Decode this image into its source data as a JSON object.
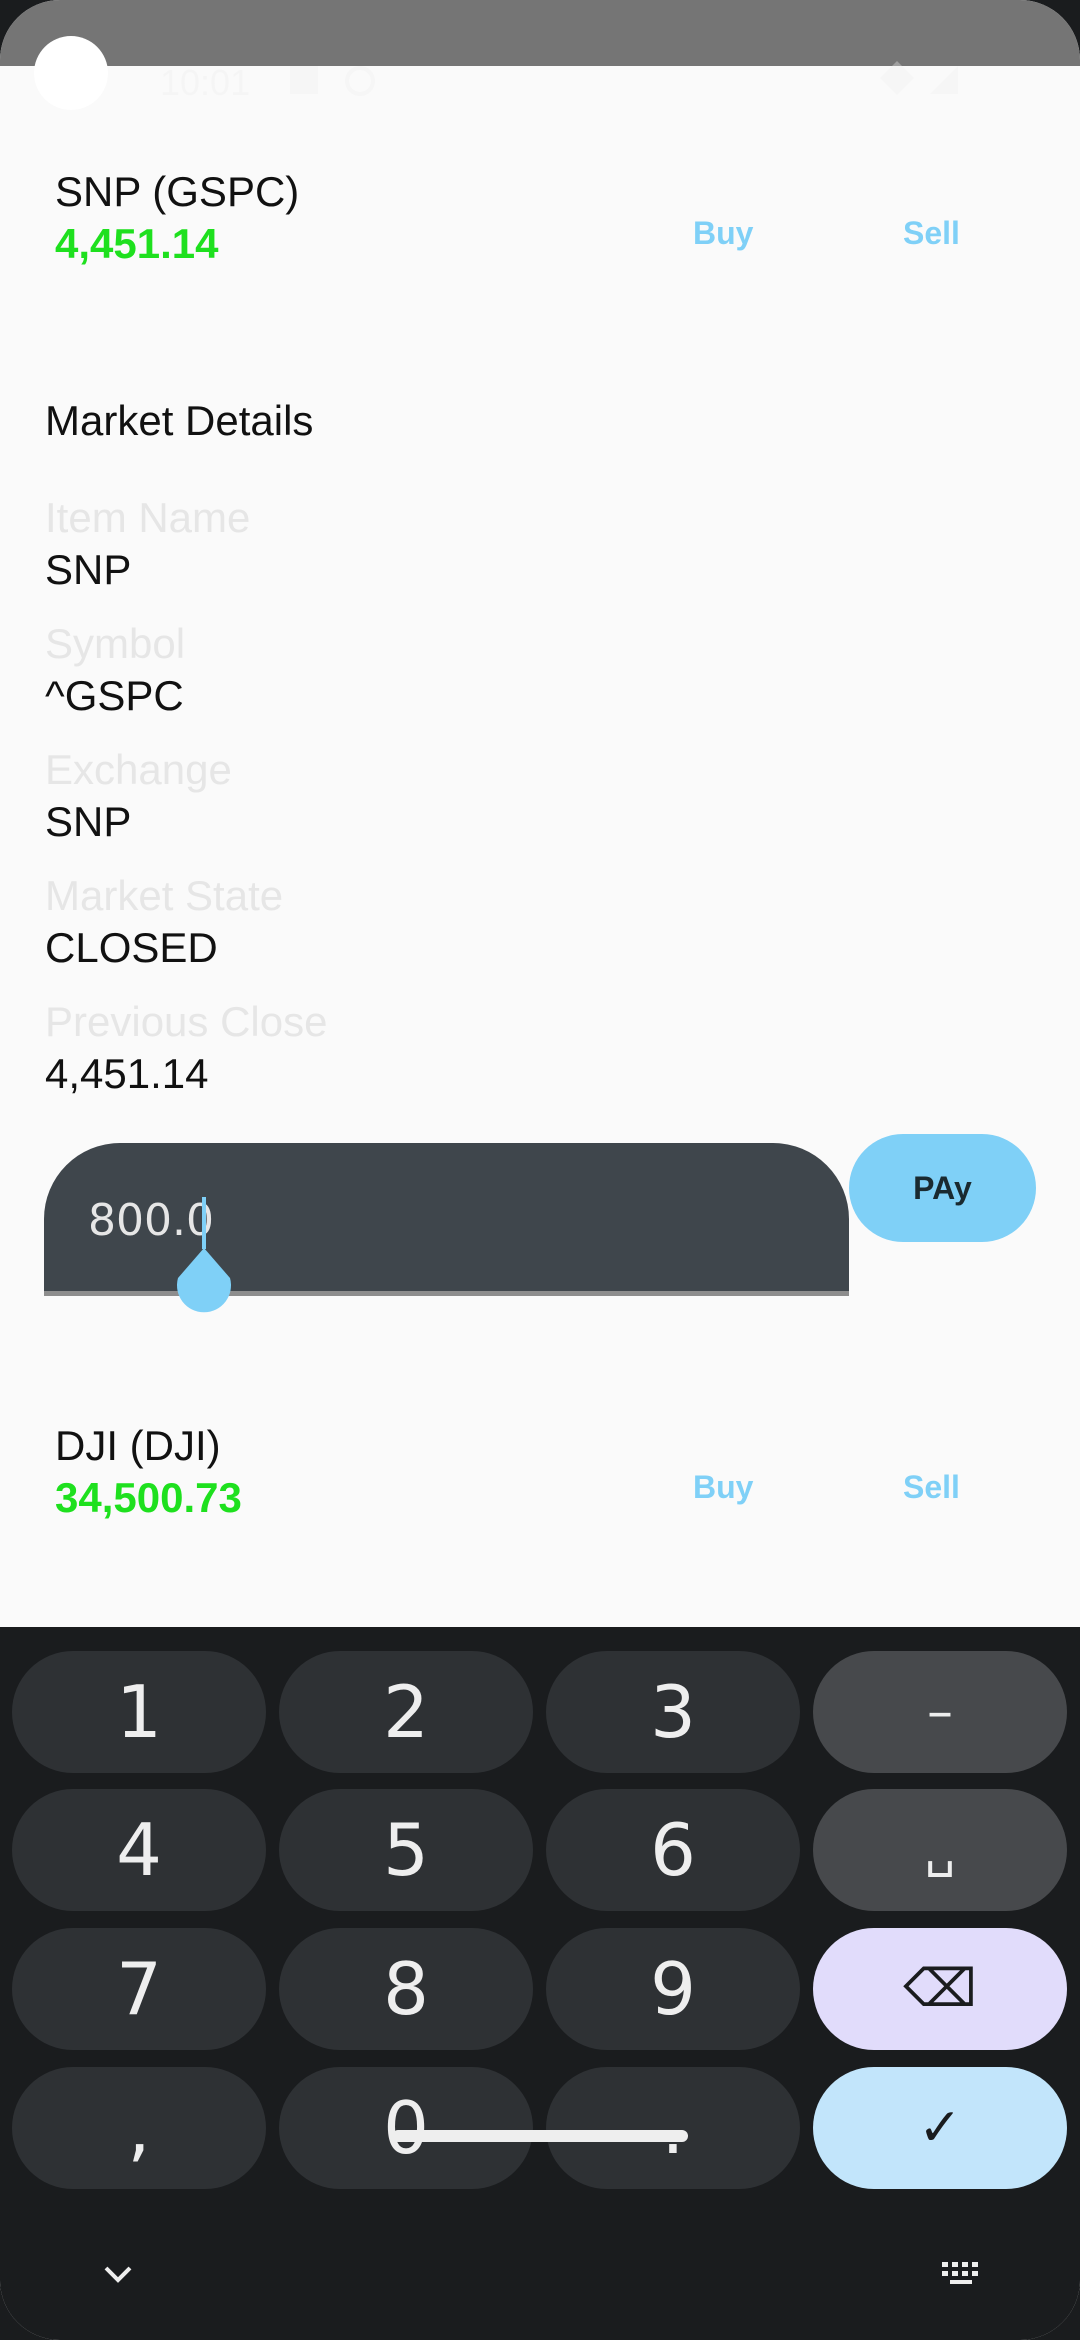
{
  "status_bar": {
    "time": "10:01"
  },
  "stocks": [
    {
      "name": "SNP (GSPC)",
      "price": "4,451.14",
      "buy": "Buy",
      "sell": "Sell"
    },
    {
      "name": "DJI (DJI)",
      "price": "34,500.73",
      "buy": "Buy",
      "sell": "Sell"
    }
  ],
  "details": {
    "title": "Market Details",
    "fields": [
      {
        "label": "Item Name",
        "value": "SNP"
      },
      {
        "label": "Symbol",
        "value": "^GSPC"
      },
      {
        "label": "Exchange",
        "value": "SNP"
      },
      {
        "label": "Market State",
        "value": "CLOSED"
      },
      {
        "label": "Previous Close",
        "value": "4,451.14"
      }
    ]
  },
  "amount": {
    "value": "800.0"
  },
  "pay_label": "PAy",
  "keyboard": {
    "keys": [
      "1",
      "2",
      "3",
      "–",
      "4",
      "5",
      "6",
      "␣",
      "7",
      "8",
      "9",
      "⌫",
      ",",
      "0",
      ".",
      "✓"
    ]
  },
  "colors": {
    "accent": "#7fd0f7",
    "price_green": "#1ee01e",
    "field_bg": "#3f464c"
  }
}
